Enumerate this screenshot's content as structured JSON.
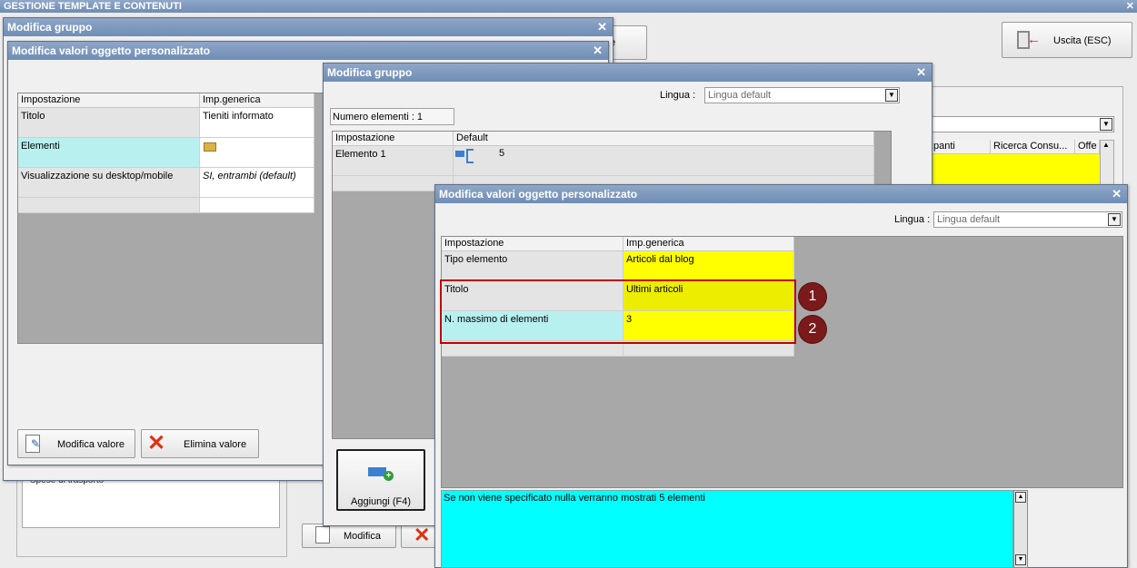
{
  "app": {
    "title": "GESTIONE TEMPLATE E CONTENUTI",
    "close": "✕"
  },
  "exit_button": {
    "label": "Uscita (ESC)"
  },
  "bg": {
    "partial_button_text": "e",
    "table_headers": [
      "panti",
      "Ricerca Consu...",
      "Offe"
    ],
    "tree_item": "Spese di trasporto"
  },
  "win1": {
    "title": "Modifica gruppo",
    "close": "✕",
    "modify_button": "Modifica"
  },
  "win2": {
    "title": "Modifica valori oggetto personalizzato",
    "close": "✕",
    "headers": [
      "Impostazione",
      "Imp.generica"
    ],
    "rows": [
      {
        "label": "Titolo",
        "value": "Tieniti informato"
      },
      {
        "label": "Elementi",
        "value": ""
      },
      {
        "label": "Visualizzazione su desktop/mobile",
        "value": "SI, entrambi (default)"
      }
    ],
    "btn_modify": "Modifica valore",
    "btn_delete": "Elimina valore"
  },
  "win3": {
    "title": "Modifica gruppo",
    "close": "✕",
    "lingua_label": "Lingua :",
    "lingua_value": "Lingua default",
    "count_label": "Numero elementi : 1",
    "headers": [
      "Impostazione",
      "Default"
    ],
    "rows": [
      {
        "label": "Elemento 1",
        "value": "5"
      }
    ],
    "add_button": "Aggiungi (F4)"
  },
  "win4": {
    "title": "Modifica valori oggetto personalizzato",
    "close": "✕",
    "lingua_label": "Lingua :",
    "lingua_value": "Lingua default",
    "headers": [
      "Impostazione",
      "Imp.generica"
    ],
    "rows": [
      {
        "label": "Tipo elemento",
        "value": "Articoli dal blog"
      },
      {
        "label": "Titolo",
        "value": "Ultimi articoli"
      },
      {
        "label": "N. massimo di elementi",
        "value": "3"
      }
    ],
    "badges": [
      "1",
      "2"
    ],
    "note": "Se non viene specificato nulla verranno mostrati 5 elementi"
  },
  "colors": {
    "highlight": "#ffff00",
    "cyan_row": "#b8f0f0",
    "note_bg": "#00ffff",
    "callout_border": "#c00000",
    "badge": "#7a1a1a"
  }
}
